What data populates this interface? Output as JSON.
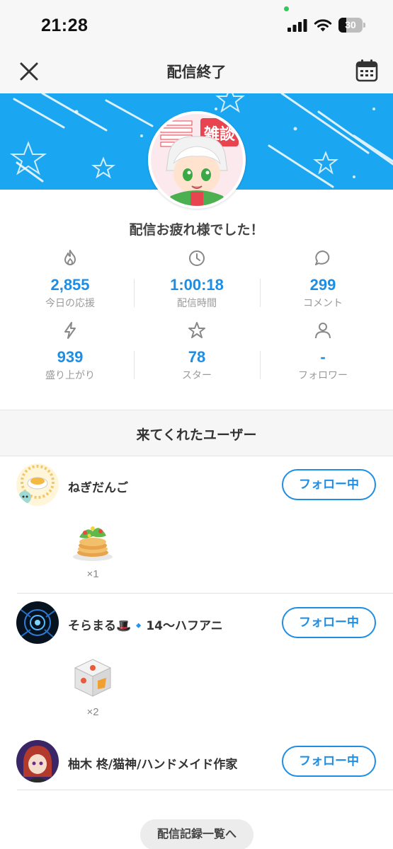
{
  "status_bar": {
    "time": "21:28",
    "battery": "30"
  },
  "nav": {
    "title": "配信終了",
    "close_icon": "close-icon",
    "calendar_icon": "calendar-icon"
  },
  "greeting": "配信お疲れ様でした！",
  "stats": [
    {
      "icon": "flame-icon",
      "value": "2,855",
      "label": "今日の応援"
    },
    {
      "icon": "clock-icon",
      "value": "1:00:18",
      "label": "配信時間"
    },
    {
      "icon": "comment-icon",
      "value": "299",
      "label": "コメント"
    },
    {
      "icon": "bolt-icon",
      "value": "939",
      "label": "盛り上がり"
    },
    {
      "icon": "star-icon",
      "value": "78",
      "label": "スター"
    },
    {
      "icon": "person-icon",
      "value": "-",
      "label": "フォロワー"
    }
  ],
  "visitors_title": "来てくれたユーザー",
  "users": [
    {
      "name": "ねぎだんご",
      "follow_label": "フォロー中",
      "gift_count": "×1"
    },
    {
      "name": "そらまる🎩🔹14〜ハフアニ",
      "follow_label": "フォロー中",
      "gift_count": "×2"
    },
    {
      "name": "柚木 柊/猫神/ハンドメイド作家",
      "follow_label": "フォロー中"
    }
  ],
  "history_button": "配信記録一覧へ",
  "colors": {
    "accent": "#1e8ee4",
    "banner": "#1aa6f0"
  }
}
